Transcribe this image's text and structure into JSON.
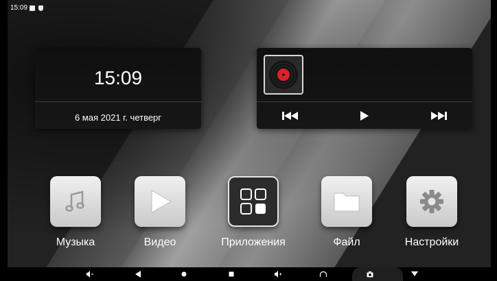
{
  "status_bar": {
    "time": "15:09"
  },
  "clock_widget": {
    "time": "15:09",
    "date": "6 мая 2021 г. четверг"
  },
  "media_widget": {
    "controls": [
      "prev",
      "play",
      "next"
    ]
  },
  "apps": [
    {
      "label": "Музыка",
      "icon": "music-note-icon"
    },
    {
      "label": "Видео",
      "icon": "play-icon"
    },
    {
      "label": "Приложения",
      "icon": "app-grid-icon"
    },
    {
      "label": "Файл",
      "icon": "folder-icon"
    },
    {
      "label": "Настройки",
      "icon": "gear-icon"
    }
  ],
  "nav_bar": {
    "icons": [
      "volume-down-icon",
      "back-icon",
      "home-icon",
      "recents-icon",
      "volume-up-icon",
      "headphones-icon",
      "camera-icon",
      "triangle-down-icon"
    ]
  },
  "colors": {
    "record": "#d8232a",
    "card_bg": "#121212",
    "icon_bg": "#e0e0e0"
  }
}
